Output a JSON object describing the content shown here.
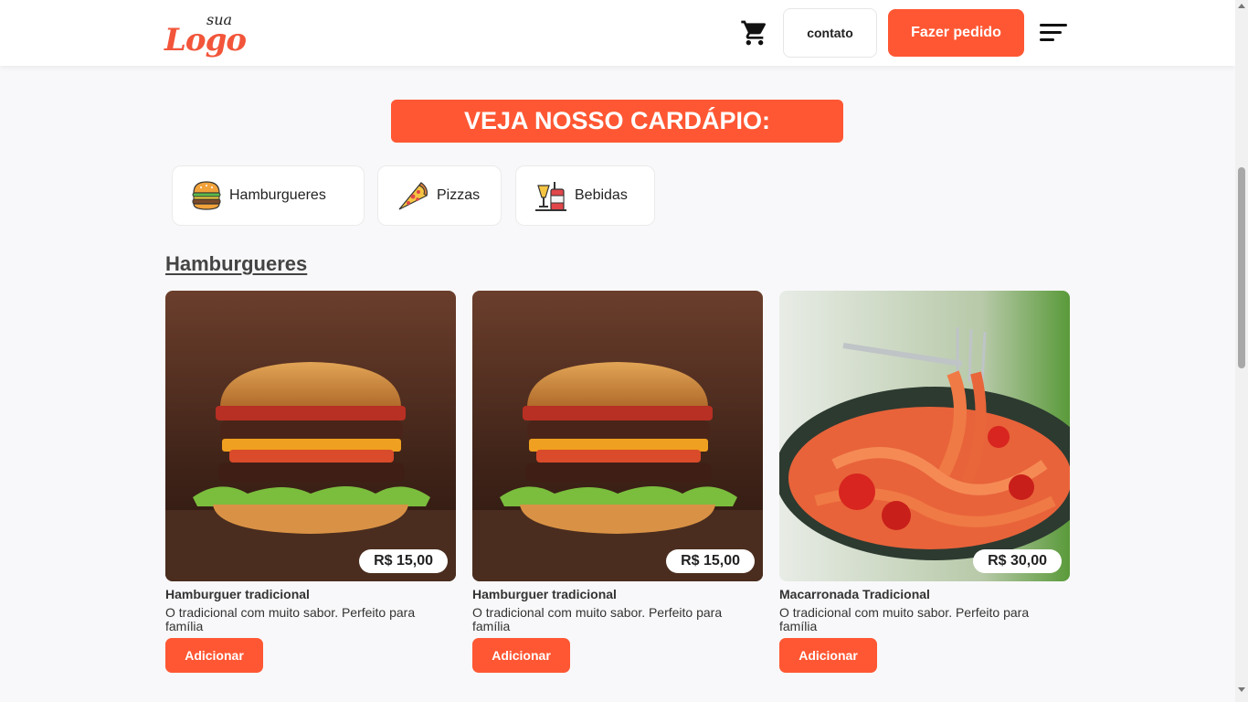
{
  "header": {
    "logo_small": "sua",
    "logo_main": "Logo",
    "cart_icon": "shopping-cart-icon",
    "contato_label": "contato",
    "pedido_label": "Fazer pedido",
    "menu_icon": "sort-menu-icon"
  },
  "menu_title": "VEJA NOSSO CARDÁPIO:",
  "categories": [
    {
      "label": "Hamburgueres",
      "icon": "burger-icon"
    },
    {
      "label": "Pizzas",
      "icon": "pizza-slice-icon"
    },
    {
      "label": "Bebidas",
      "icon": "drinks-icon"
    }
  ],
  "section_title": "Hamburgueres",
  "products": [
    {
      "name": "Hamburguer tradicional",
      "description": "O tradicional com muito sabor. Perfeito para família",
      "price": "R$ 15,00",
      "button": "Adicionar",
      "image": "burger-photo"
    },
    {
      "name": "Hamburguer tradicional",
      "description": "O tradicional com muito sabor. Perfeito para família",
      "price": "R$ 15,00",
      "button": "Adicionar",
      "image": "burger-photo"
    },
    {
      "name": "Macarronada Tradicional",
      "description": "O tradicional com muito sabor. Perfeito para família",
      "price": "R$ 30,00",
      "button": "Adicionar",
      "image": "pasta-photo"
    }
  ],
  "colors": {
    "accent": "#ff5733",
    "background": "#f8f8fa",
    "text": "#333333"
  }
}
